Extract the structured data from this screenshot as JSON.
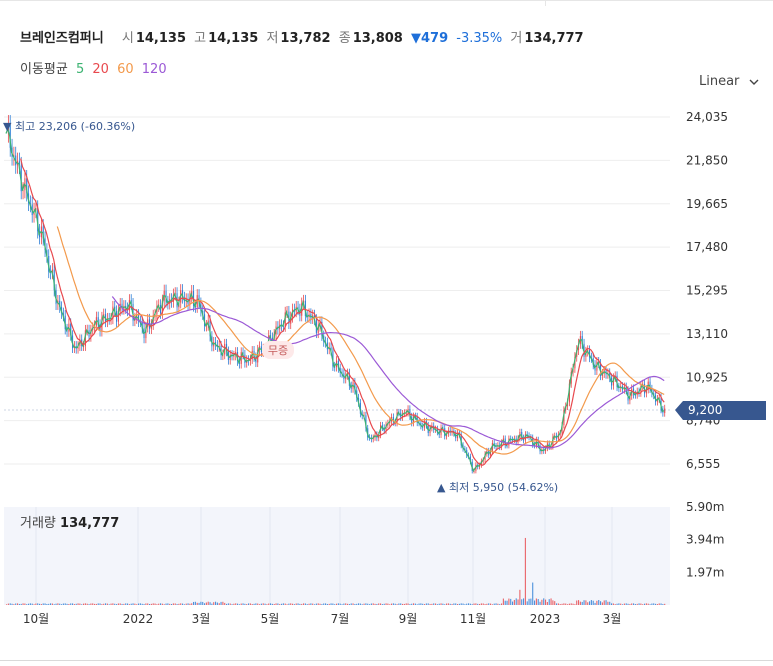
{
  "stock": {
    "name": "브레인즈컴퍼니",
    "open_label": "시",
    "open": "14,135",
    "high_label": "고",
    "high": "14,135",
    "low_label": "저",
    "low": "13,782",
    "close_label": "종",
    "close": "13,808",
    "change": "▼479",
    "change_pct": "-3.35%",
    "volume_label": "거",
    "volume": "134,777"
  },
  "ma": {
    "label": "이동평균",
    "periods": [
      {
        "value": "5",
        "color": "#3cb371"
      },
      {
        "value": "20",
        "color": "#e8494e"
      },
      {
        "value": "60",
        "color": "#f39a4c"
      },
      {
        "value": "120",
        "color": "#9b59d6"
      }
    ]
  },
  "scale": {
    "label": "Linear",
    "icon": "chevron-down-icon"
  },
  "annotations": {
    "high_text": "▼ 최고 23,206 (-60.36%)",
    "low_text": "▲ 최저 5,950 (54.62%)",
    "event_badge": "무증",
    "current_price": "9,200"
  },
  "volume_panel": {
    "label": "거래량",
    "value": "134,777"
  },
  "colors": {
    "up": "#e8494e",
    "down": "#2e7fd6",
    "ma5": "#3cb371",
    "ma20": "#e8494e",
    "ma60": "#f39a4c",
    "ma120": "#9b59d6",
    "price_tag": "#37578f"
  },
  "chart_data": {
    "type": "candlestick",
    "y_ticks": [
      "24,035",
      "21,850",
      "19,665",
      "17,480",
      "15,295",
      "13,110",
      "10,925",
      "8,740",
      "6,555"
    ],
    "ylim": [
      6555,
      24035
    ],
    "volume_ticks": [
      "5.90m",
      "3.94m",
      "1.97m"
    ],
    "volume_ylim": [
      0,
      5900000
    ],
    "x_tick_labels": [
      "10월",
      "2022",
      "3월",
      "5월",
      "7월",
      "9월",
      "11월",
      "2023",
      "3월"
    ],
    "close_path": [
      {
        "x": "2021-09",
        "y": 23206
      },
      {
        "x": "2021-09",
        "y": 20500
      },
      {
        "x": "2021-10",
        "y": 18200
      },
      {
        "x": "2021-10",
        "y": 14500
      },
      {
        "x": "2021-10",
        "y": 12300
      },
      {
        "x": "2021-11",
        "y": 13500
      },
      {
        "x": "2021-11",
        "y": 14000
      },
      {
        "x": "2021-11",
        "y": 14600
      },
      {
        "x": "2021-12",
        "y": 13200
      },
      {
        "x": "2021-12",
        "y": 14800
      },
      {
        "x": "2022-01",
        "y": 14900
      },
      {
        "x": "2022-01",
        "y": 14800
      },
      {
        "x": "2022-02",
        "y": 12500
      },
      {
        "x": "2022-02",
        "y": 12000
      },
      {
        "x": "2022-03",
        "y": 11800
      },
      {
        "x": "2022-03",
        "y": 12500
      },
      {
        "x": "2022-04",
        "y": 13800
      },
      {
        "x": "2022-04",
        "y": 14500
      },
      {
        "x": "2022-05",
        "y": 13500
      },
      {
        "x": "2022-05",
        "y": 11500
      },
      {
        "x": "2022-06",
        "y": 10500
      },
      {
        "x": "2022-06",
        "y": 7700
      },
      {
        "x": "2022-07",
        "y": 8600
      },
      {
        "x": "2022-07",
        "y": 9200
      },
      {
        "x": "2022-08",
        "y": 8500
      },
      {
        "x": "2022-08",
        "y": 8200
      },
      {
        "x": "2022-09",
        "y": 8100
      },
      {
        "x": "2022-10",
        "y": 6200
      },
      {
        "x": "2022-10",
        "y": 7400
      },
      {
        "x": "2022-11",
        "y": 7700
      },
      {
        "x": "2022-12",
        "y": 8000
      },
      {
        "x": "2022-12",
        "y": 7200
      },
      {
        "x": "2023-01",
        "y": 8200
      },
      {
        "x": "2023-01",
        "y": 12800
      },
      {
        "x": "2023-02",
        "y": 11500
      },
      {
        "x": "2023-02",
        "y": 10800
      },
      {
        "x": "2023-03",
        "y": 10000
      },
      {
        "x": "2023-03",
        "y": 10500
      },
      {
        "x": "2023-04",
        "y": 9200
      }
    ]
  }
}
